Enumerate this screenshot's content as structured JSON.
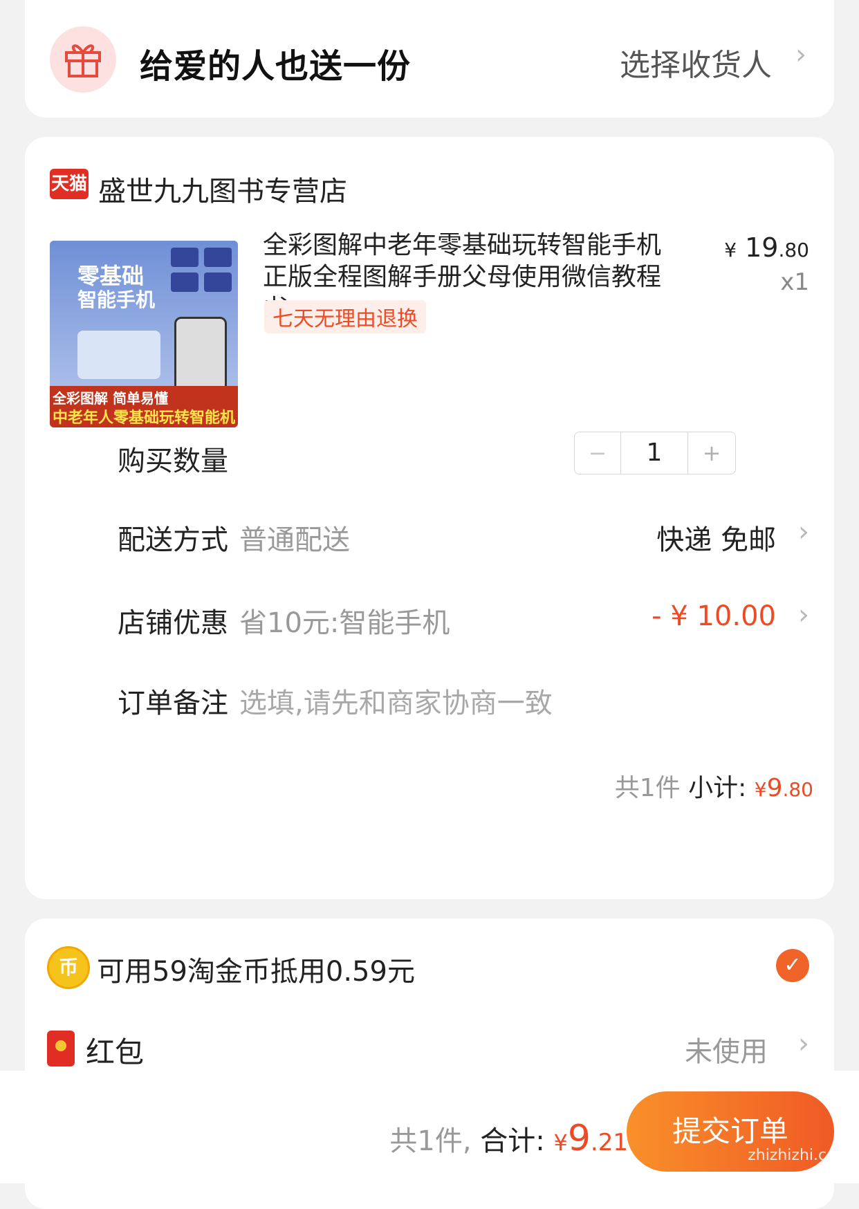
{
  "gift": {
    "title": "给爱的人也送一份",
    "action": "选择收货人"
  },
  "shop": {
    "logo_text": "天猫",
    "name": "盛世九九图书专营店"
  },
  "product": {
    "image_title_1": "零基础",
    "image_title_2": "智能手机",
    "image_banner_1": "全彩图解 简单易懂",
    "image_banner_2": "中老年人零基础玩转智能机",
    "title": "全彩图解中老年零基础玩转智能手机正版全程图解手册父母使用微信教程书…",
    "badge": "七天无理由退换",
    "price_symbol": "¥",
    "price_int": "19",
    "price_dec": ".80",
    "quantity_label": "x1"
  },
  "rows": {
    "quantity_label": "购买数量",
    "quantity_minus": "−",
    "quantity_value": "1",
    "quantity_plus": "+",
    "delivery_label": "配送方式",
    "delivery_sub": "普通配送",
    "delivery_value": "快递 免邮",
    "discount_label": "店铺优惠",
    "discount_sub": "省10元:智能手机",
    "discount_value": "- ¥ 10.00",
    "note_label": "订单备注",
    "note_placeholder": "选填,请先和商家协商一致"
  },
  "subtotal": {
    "count": "共1件",
    "label": "小计:",
    "symbol": "¥",
    "int": "9",
    "dec": ".80"
  },
  "coins": {
    "icon_text": "币",
    "text": "可用59淘金币抵用0.59元",
    "check": "✓"
  },
  "redpacket": {
    "label": "红包",
    "status": "未使用"
  },
  "footer": {
    "count": "共1件,",
    "label": "合计:",
    "symbol": "¥",
    "int": "9",
    "dec": ".21",
    "submit": "提交订单",
    "watermark": "zhizhizhi.com"
  },
  "colors": {
    "accent": "#ee4a24",
    "submit_start": "#f9902a",
    "submit_end": "#f05a25",
    "tmall_red": "#e02e24"
  }
}
